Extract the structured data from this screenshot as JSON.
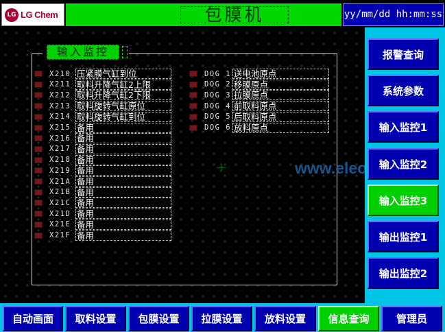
{
  "header": {
    "logo_mark": "LG",
    "logo_text": "LG Chem",
    "title": "包膜机",
    "datetime": "yy/mm/dd hh:mm:ss"
  },
  "panel": {
    "title": "输入监控"
  },
  "inputs_left": [
    {
      "code": "X210",
      "label": "压紧膜气缸到位"
    },
    {
      "code": "X211",
      "label": "取料升降气缸2上限"
    },
    {
      "code": "X212",
      "label": "取料升降气缸2下限"
    },
    {
      "code": "X213",
      "label": "取料旋转气缸原位"
    },
    {
      "code": "X214",
      "label": "取料旋转气缸到位"
    },
    {
      "code": "X215",
      "label": "备用"
    },
    {
      "code": "X216",
      "label": "备用"
    },
    {
      "code": "X217",
      "label": "备用"
    },
    {
      "code": "X218",
      "label": "备用"
    },
    {
      "code": "X219",
      "label": "备用"
    },
    {
      "code": "X21A",
      "label": "备用"
    },
    {
      "code": "X21B",
      "label": "备用"
    },
    {
      "code": "X21C",
      "label": "备用"
    },
    {
      "code": "X21D",
      "label": "备用"
    },
    {
      "code": "X21E",
      "label": "备用"
    },
    {
      "code": "X21F",
      "label": "备用"
    }
  ],
  "inputs_right": [
    {
      "code": "DOG 1",
      "label": "送电池原点"
    },
    {
      "code": "DOG 2",
      "label": "移膜原点"
    },
    {
      "code": "DOG 3",
      "label": "拉膜原点"
    },
    {
      "code": "DOG 4",
      "label": "前取料原点"
    },
    {
      "code": "DOG 5",
      "label": "后取料原点"
    },
    {
      "code": "DOG 6",
      "label": "放料原点"
    }
  ],
  "watermark": "www.eleok.com",
  "side_nav": [
    {
      "label": "报警查询",
      "active": false
    },
    {
      "label": "系统参数",
      "active": false
    },
    {
      "label": "输入监控1",
      "active": false
    },
    {
      "label": "输入监控2",
      "active": false
    },
    {
      "label": "输入监控3",
      "active": true
    },
    {
      "label": "输出监控1",
      "active": false
    },
    {
      "label": "输出监控2",
      "active": false
    }
  ],
  "bottom_nav": [
    {
      "label": "自动画面",
      "active": false
    },
    {
      "label": "取料设置",
      "active": false
    },
    {
      "label": "包膜设置",
      "active": false
    },
    {
      "label": "拉膜设置",
      "active": false
    },
    {
      "label": "放料设置",
      "active": false
    },
    {
      "label": "信息查询",
      "active": true
    },
    {
      "label": "管理员",
      "active": false
    }
  ],
  "colors": {
    "title_green": "#00d800",
    "nav_blue": "#0000b0",
    "active_green": "#00d000",
    "frame_cyan": "#00c4e6",
    "led_off": "#6e1a1a"
  }
}
